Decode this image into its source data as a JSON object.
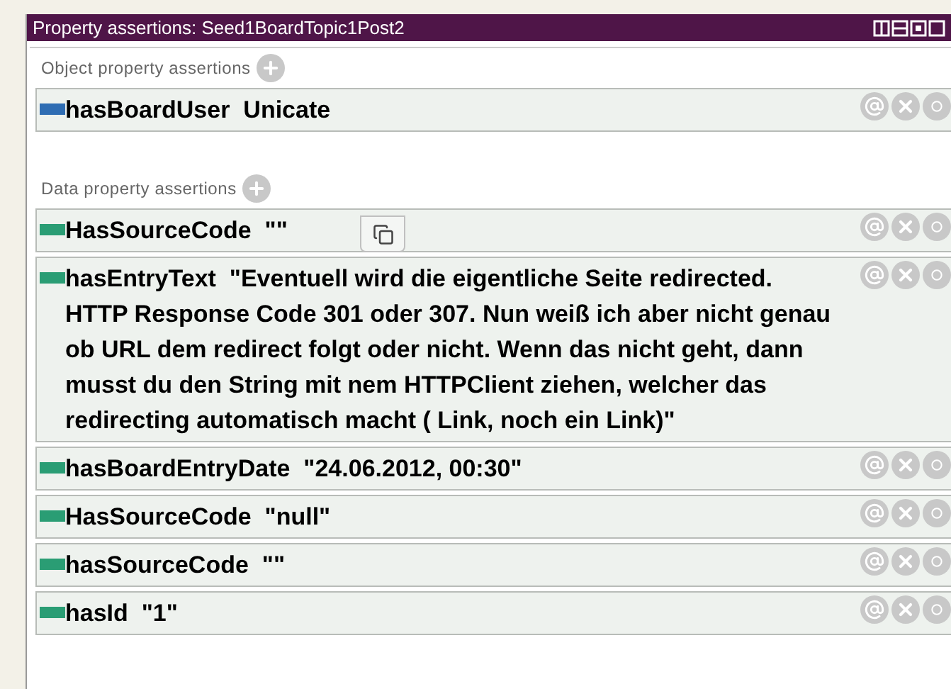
{
  "window": {
    "title": "Property assertions: Seed1BoardTopic1Post2"
  },
  "sections": [
    {
      "title": "Object property assertions",
      "items": [
        {
          "property": "hasBoardUser",
          "value": "Unicate",
          "color": "#2f6db3"
        }
      ]
    },
    {
      "title": "Data property assertions",
      "items": [
        {
          "property": "HasSourceCode",
          "value": "\"\"",
          "color": "#2a9d74"
        },
        {
          "property": "hasEntryText",
          "value": "\"Eventuell wird die eigentliche Seite redirected. HTTP Response Code 301 oder 307. Nun weiß ich aber nicht genau ob URL dem redirect folgt oder nicht. Wenn das nicht geht, dann musst du den String mit nem HTTPClient ziehen, welcher das redirecting automatisch macht ( Link, noch ein Link)\"",
          "color": "#2a9d74"
        },
        {
          "property": "hasBoardEntryDate",
          "value": "\"24.06.2012, 00:30\"",
          "color": "#2a9d74"
        },
        {
          "property": "HasSourceCode",
          "value": "\"null\"",
          "color": "#2a9d74"
        },
        {
          "property": "hasSourceCode",
          "value": "\"\"",
          "color": "#2a9d74"
        },
        {
          "property": "hasId",
          "value": "\"1\"",
          "color": "#2a9d74"
        }
      ]
    }
  ]
}
